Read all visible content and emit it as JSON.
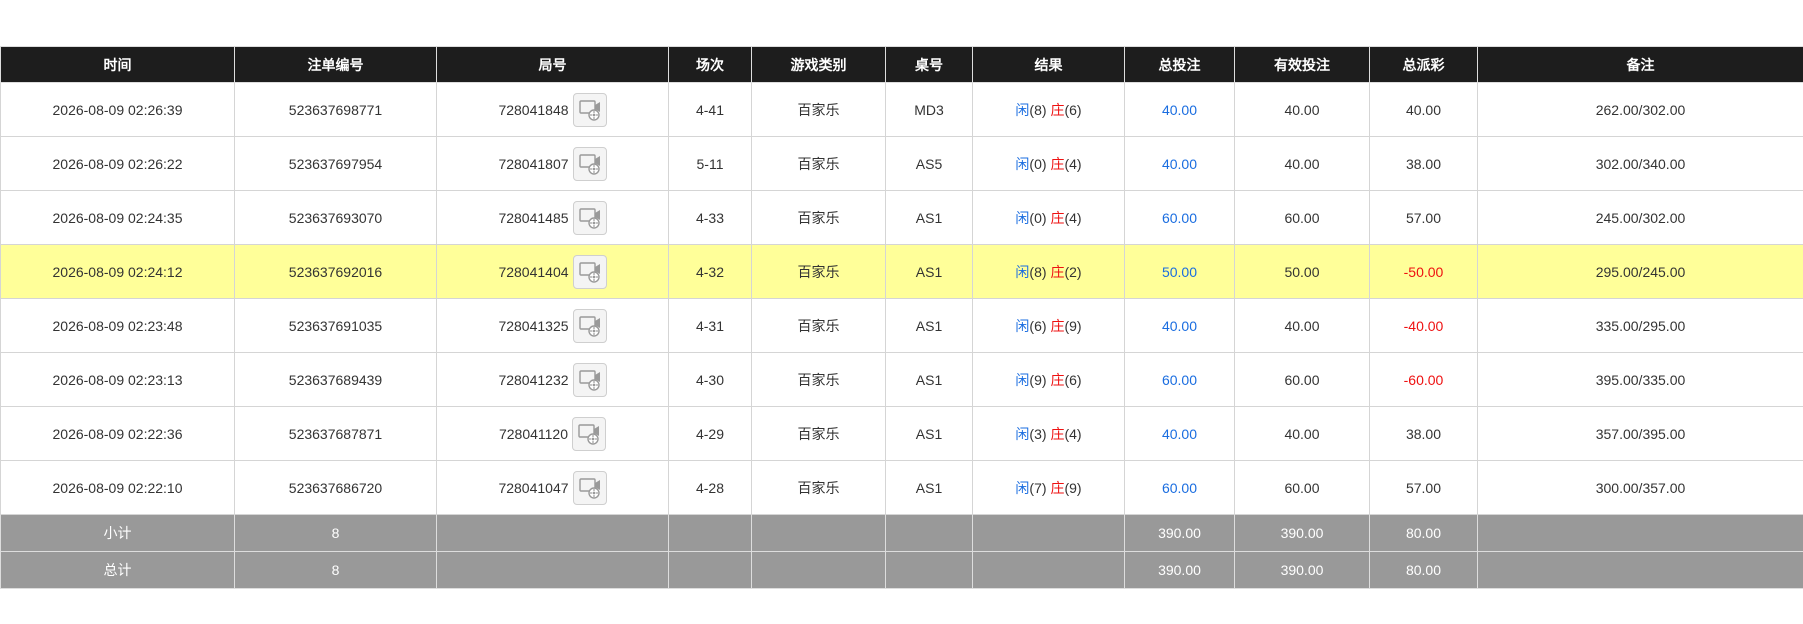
{
  "headers": [
    "时间",
    "注单编号",
    "局号",
    "场次",
    "游戏类别",
    "桌号",
    "结果",
    "总投注",
    "有效投注",
    "总派彩",
    "备注"
  ],
  "result_labels": {
    "player": "闲",
    "banker": "庄"
  },
  "rows": [
    {
      "time": "2026-08-09 02:26:39",
      "bet_id": "523637698771",
      "round_id": "728041848",
      "session": "4-41",
      "game": "百家乐",
      "table": "MD3",
      "player_score": "(8)",
      "banker_score": "(6)",
      "total_bet": "40.00",
      "valid_bet": "40.00",
      "payout": "40.00",
      "payout_negative": false,
      "remark": "262.00/302.00",
      "highlighted": false
    },
    {
      "time": "2026-08-09 02:26:22",
      "bet_id": "523637697954",
      "round_id": "728041807",
      "session": "5-11",
      "game": "百家乐",
      "table": "AS5",
      "player_score": "(0)",
      "banker_score": "(4)",
      "total_bet": "40.00",
      "valid_bet": "40.00",
      "payout": "38.00",
      "payout_negative": false,
      "remark": "302.00/340.00",
      "highlighted": false
    },
    {
      "time": "2026-08-09 02:24:35",
      "bet_id": "523637693070",
      "round_id": "728041485",
      "session": "4-33",
      "game": "百家乐",
      "table": "AS1",
      "player_score": "(0)",
      "banker_score": "(4)",
      "total_bet": "60.00",
      "valid_bet": "60.00",
      "payout": "57.00",
      "payout_negative": false,
      "remark": "245.00/302.00",
      "highlighted": false
    },
    {
      "time": "2026-08-09 02:24:12",
      "bet_id": "523637692016",
      "round_id": "728041404",
      "session": "4-32",
      "game": "百家乐",
      "table": "AS1",
      "player_score": "(8)",
      "banker_score": "(2)",
      "total_bet": "50.00",
      "valid_bet": "50.00",
      "payout": "-50.00",
      "payout_negative": true,
      "remark": "295.00/245.00",
      "highlighted": true
    },
    {
      "time": "2026-08-09 02:23:48",
      "bet_id": "523637691035",
      "round_id": "728041325",
      "session": "4-31",
      "game": "百家乐",
      "table": "AS1",
      "player_score": "(6)",
      "banker_score": "(9)",
      "total_bet": "40.00",
      "valid_bet": "40.00",
      "payout": "-40.00",
      "payout_negative": true,
      "remark": "335.00/295.00",
      "highlighted": false
    },
    {
      "time": "2026-08-09 02:23:13",
      "bet_id": "523637689439",
      "round_id": "728041232",
      "session": "4-30",
      "game": "百家乐",
      "table": "AS1",
      "player_score": "(9)",
      "banker_score": "(6)",
      "total_bet": "60.00",
      "valid_bet": "60.00",
      "payout": "-60.00",
      "payout_negative": true,
      "remark": "395.00/335.00",
      "highlighted": false
    },
    {
      "time": "2026-08-09 02:22:36",
      "bet_id": "523637687871",
      "round_id": "728041120",
      "session": "4-29",
      "game": "百家乐",
      "table": "AS1",
      "player_score": "(3)",
      "banker_score": "(4)",
      "total_bet": "40.00",
      "valid_bet": "40.00",
      "payout": "38.00",
      "payout_negative": false,
      "remark": "357.00/395.00",
      "highlighted": false
    },
    {
      "time": "2026-08-09 02:22:10",
      "bet_id": "523637686720",
      "round_id": "728041047",
      "session": "4-28",
      "game": "百家乐",
      "table": "AS1",
      "player_score": "(7)",
      "banker_score": "(9)",
      "total_bet": "60.00",
      "valid_bet": "60.00",
      "payout": "57.00",
      "payout_negative": false,
      "remark": "300.00/357.00",
      "highlighted": false
    }
  ],
  "footer": {
    "subtotal": {
      "label": "小计",
      "count": "8",
      "total_bet": "390.00",
      "valid_bet": "390.00",
      "payout": "80.00"
    },
    "total": {
      "label": "总计",
      "count": "8",
      "total_bet": "390.00",
      "valid_bet": "390.00",
      "payout": "80.00"
    }
  },
  "colors": {
    "header_bg": "#1d1d1d",
    "highlight_row": "#ffff99",
    "footer_bg": "#999999",
    "amount_blue": "#1a6de0",
    "negative_red": "#ee1111"
  },
  "icons": {
    "round_video": "video-replay-icon"
  }
}
